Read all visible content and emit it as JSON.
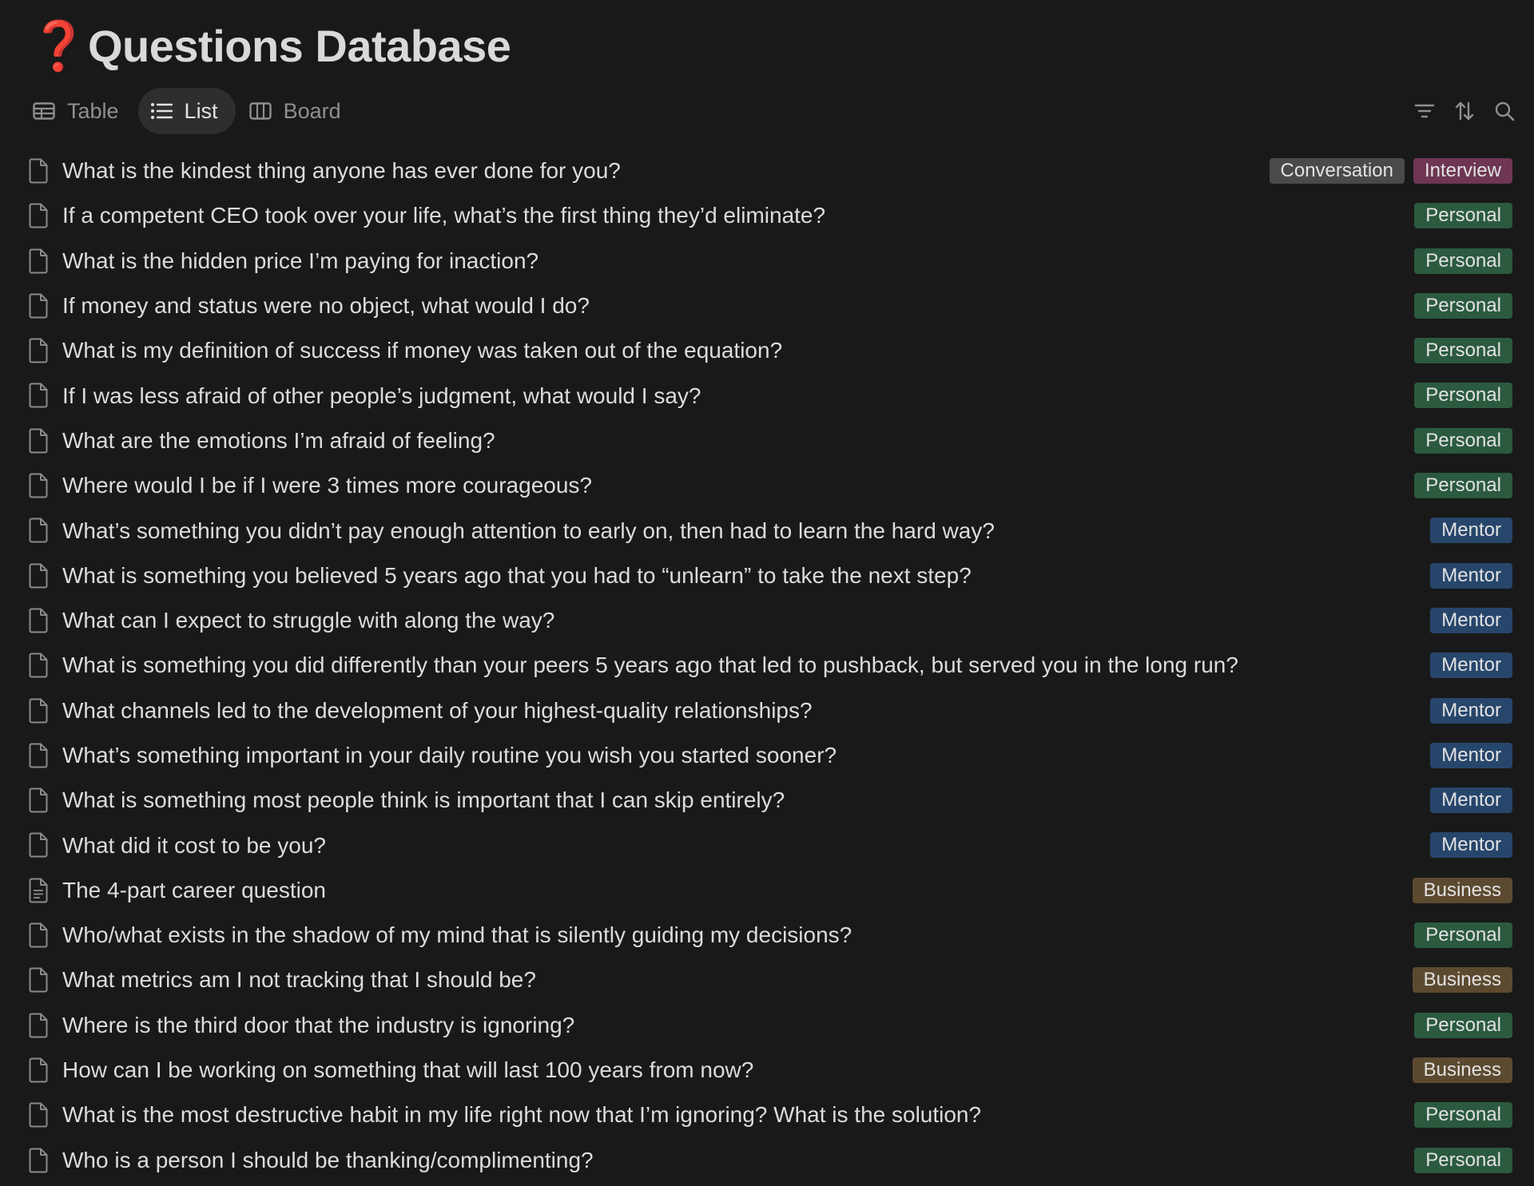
{
  "page": {
    "emoji": "❓",
    "title": "Questions Database"
  },
  "views": [
    {
      "label": "Table",
      "icon": "table-icon",
      "active": false
    },
    {
      "label": "List",
      "icon": "list-icon",
      "active": true
    },
    {
      "label": "Board",
      "icon": "board-icon",
      "active": false
    }
  ],
  "tools": [
    "filter-icon",
    "sort-icon",
    "search-icon"
  ],
  "tag_colors": {
    "Conversation": "#4a4a4a",
    "Interview": "#6e3652",
    "Personal": "#2b5a3f",
    "Mentor": "#27466b",
    "Business": "#5c4a30"
  },
  "rows": [
    {
      "question": "What is the kindest thing anyone has ever done for you?",
      "tags": [
        "Conversation",
        "Interview"
      ],
      "icon": "page-icon"
    },
    {
      "question": "If a competent CEO took over your life, what’s the first thing they’d eliminate?",
      "tags": [
        "Personal"
      ],
      "icon": "page-icon"
    },
    {
      "question": "What is the hidden price I’m paying for inaction?",
      "tags": [
        "Personal"
      ],
      "icon": "page-icon"
    },
    {
      "question": "If money and status were no object, what would I do?",
      "tags": [
        "Personal"
      ],
      "icon": "page-icon"
    },
    {
      "question": "What is my definition of success if money was taken out of the equation?",
      "tags": [
        "Personal"
      ],
      "icon": "page-icon"
    },
    {
      "question": "If I was less afraid of other people’s judgment, what would I say?",
      "tags": [
        "Personal"
      ],
      "icon": "page-icon"
    },
    {
      "question": "What are the emotions I’m afraid of feeling?",
      "tags": [
        "Personal"
      ],
      "icon": "page-icon"
    },
    {
      "question": "Where would I be if I were 3 times more courageous?",
      "tags": [
        "Personal"
      ],
      "icon": "page-icon"
    },
    {
      "question": "What’s something you didn’t pay enough attention to early on, then had to learn the hard way?",
      "tags": [
        "Mentor"
      ],
      "icon": "page-icon"
    },
    {
      "question": "What is something you believed 5 years ago that you had to “unlearn” to take the next step?",
      "tags": [
        "Mentor"
      ],
      "icon": "page-icon"
    },
    {
      "question": "What can I expect to struggle with along the way?",
      "tags": [
        "Mentor"
      ],
      "icon": "page-icon"
    },
    {
      "question": "What is something you did differently than your peers 5 years ago that led to pushback, but served you in the long run?",
      "tags": [
        "Mentor"
      ],
      "icon": "page-icon"
    },
    {
      "question": "What channels led to the development of your highest-quality relationships?",
      "tags": [
        "Mentor"
      ],
      "icon": "page-icon"
    },
    {
      "question": "What’s something important in your daily routine you wish you started sooner?",
      "tags": [
        "Mentor"
      ],
      "icon": "page-icon"
    },
    {
      "question": "What is something most people think is important that I can skip entirely?",
      "tags": [
        "Mentor"
      ],
      "icon": "page-icon"
    },
    {
      "question": "What did it cost to be you?",
      "tags": [
        "Mentor"
      ],
      "icon": "page-icon"
    },
    {
      "question": "The 4-part career question",
      "tags": [
        "Business"
      ],
      "icon": "page-text-icon"
    },
    {
      "question": "Who/what exists in the shadow of my mind that is silently guiding my decisions?",
      "tags": [
        "Personal"
      ],
      "icon": "page-icon"
    },
    {
      "question": "What metrics am I not tracking that I should be?",
      "tags": [
        "Business"
      ],
      "icon": "page-icon"
    },
    {
      "question": "Where is the third door that the industry is ignoring?",
      "tags": [
        "Personal"
      ],
      "icon": "page-icon"
    },
    {
      "question": "How can I be working on something that will last 100 years from now?",
      "tags": [
        "Business"
      ],
      "icon": "page-icon"
    },
    {
      "question": "What is the most destructive habit in my life right now that I’m ignoring? What is the solution?",
      "tags": [
        "Personal"
      ],
      "icon": "page-icon"
    },
    {
      "question": "Who is a person I should be thanking/complimenting?",
      "tags": [
        "Personal"
      ],
      "icon": "page-icon"
    }
  ]
}
